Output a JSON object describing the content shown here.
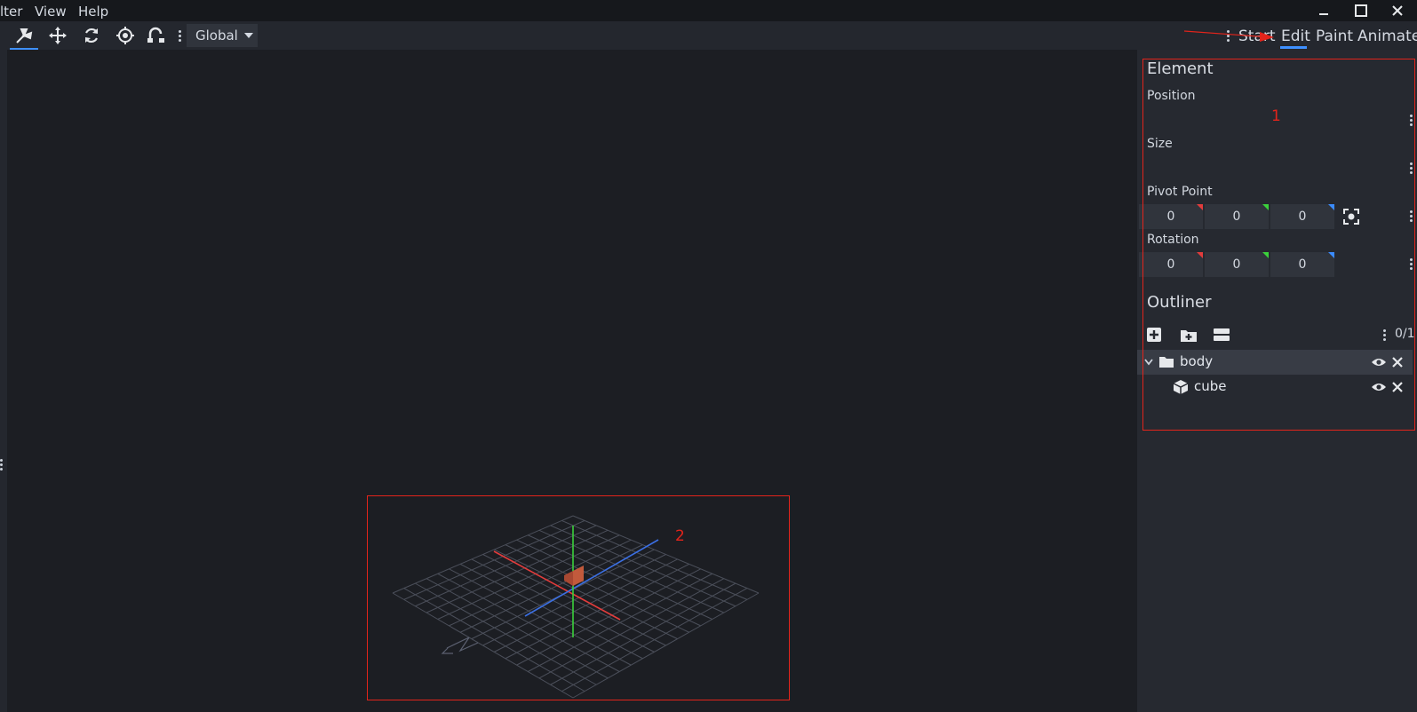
{
  "menubar": {
    "items": [
      "lter",
      "View",
      "Help"
    ]
  },
  "toolbar": {
    "space_select": "Global"
  },
  "modes": {
    "items": [
      "Start",
      "Edit",
      "Paint",
      "Animate"
    ],
    "active": "Edit"
  },
  "panel": {
    "element_title": "Element",
    "position_label": "Position",
    "size_label": "Size",
    "pivot_label": "Pivot Point",
    "pivot_values": [
      "0",
      "0",
      "0"
    ],
    "rotation_label": "Rotation",
    "rotation_values": [
      "0",
      "0",
      "0"
    ]
  },
  "outliner": {
    "title": "Outliner",
    "count": "0/1",
    "items": [
      {
        "name": "body",
        "type": "group"
      },
      {
        "name": "cube",
        "type": "cube"
      }
    ]
  },
  "annotations": {
    "label_1": "1",
    "label_2": "2"
  },
  "colors": {
    "accent": "#3e90ff",
    "axis_x": "#e23c3c",
    "axis_y": "#3bd13b",
    "axis_z": "#3b6fe2",
    "annotation": "#e2241b"
  }
}
